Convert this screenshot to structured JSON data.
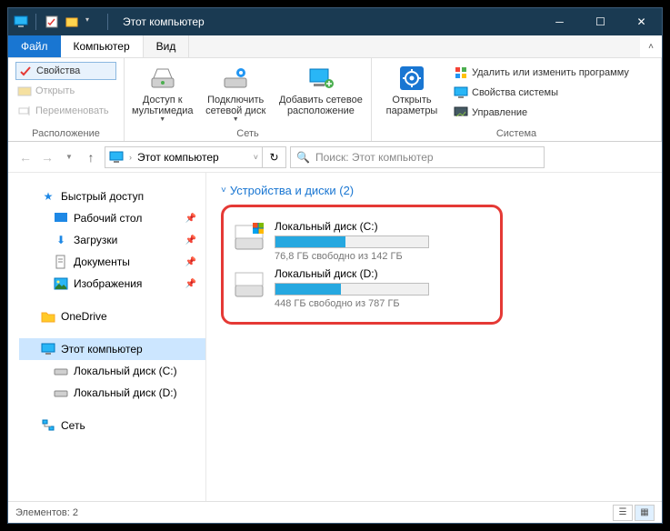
{
  "titlebar": {
    "title": "Этот компьютер"
  },
  "menu": {
    "file": "Файл",
    "computer": "Компьютер",
    "view": "Вид"
  },
  "ribbon": {
    "properties": "Свойства",
    "open": "Открыть",
    "rename": "Переименовать",
    "location_group": "Расположение",
    "media_access": "Доступ к мультимедиа",
    "map_drive": "Подключить сетевой диск",
    "add_net": "Добавить сетевое расположение",
    "network_group": "Сеть",
    "open_settings": "Открыть параметры",
    "uninstall": "Удалить или изменить программу",
    "sys_props": "Свойства системы",
    "manage": "Управление",
    "system_group": "Система"
  },
  "address": {
    "location": "Этот компьютер"
  },
  "search": {
    "placeholder": "Поиск: Этот компьютер"
  },
  "nav": {
    "quick": "Быстрый доступ",
    "desktop": "Рабочий стол",
    "downloads": "Загрузки",
    "documents": "Документы",
    "pictures": "Изображения",
    "onedrive": "OneDrive",
    "thispc": "Этот компьютер",
    "drive_c": "Локальный диск (C:)",
    "drive_d": "Локальный диск (D:)",
    "network": "Сеть"
  },
  "content": {
    "section": "Устройства и диски (2)",
    "drives": [
      {
        "name": "Локальный диск (C:)",
        "free_text": "76,8 ГБ свободно из 142 ГБ",
        "used_pct": 46
      },
      {
        "name": "Локальный диск (D:)",
        "free_text": "448 ГБ свободно из 787 ГБ",
        "used_pct": 43
      }
    ]
  },
  "status": {
    "elements": "Элементов: 2"
  }
}
